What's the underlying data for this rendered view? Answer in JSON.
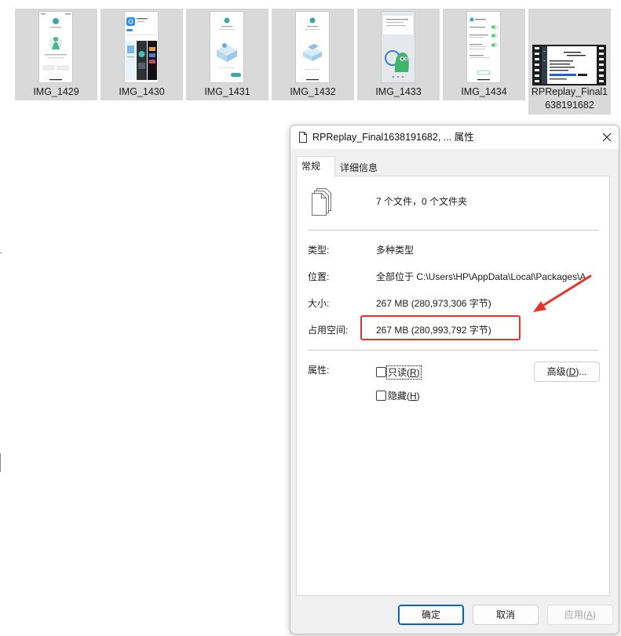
{
  "files": [
    {
      "name": "IMG_1429"
    },
    {
      "name": "IMG_1430"
    },
    {
      "name": "IMG_1431"
    },
    {
      "name": "IMG_1432"
    },
    {
      "name": "IMG_1433"
    },
    {
      "name": "IMG_1434"
    },
    {
      "name": "RPReplay_Final1638191682"
    }
  ],
  "dialog": {
    "title": "RPReplay_Final1638191682, ... 属性",
    "tabs": [
      {
        "label": "常规",
        "active": true
      },
      {
        "label": "详细信息",
        "active": false
      }
    ],
    "summary": "7 个文件，0 个文件夹",
    "rows": [
      {
        "label": "类型:",
        "value": "多种类型"
      },
      {
        "label": "位置:",
        "value": "全部位于 C:\\Users\\HP\\AppData\\Local\\Packages\\A"
      },
      {
        "label": "大小:",
        "value": "267 MB (280,973,306 字节)"
      },
      {
        "label": "占用空间:",
        "value": "267 MB (280,993,792 字节)"
      }
    ],
    "attributes_label": "属性:",
    "readonly": {
      "prefix": "只读(",
      "accel": "R",
      "suffix": ")",
      "checked": false
    },
    "hidden": {
      "prefix": "隐藏(",
      "accel": "H",
      "suffix": ")",
      "checked": false
    },
    "advanced": {
      "prefix": "高级(",
      "accel": "D",
      "suffix": ")..."
    },
    "ok_label": "确定",
    "cancel_label": "取消",
    "apply": {
      "prefix": "应用(",
      "accel": "A",
      "suffix": ")",
      "enabled": false
    }
  },
  "icons": {
    "title": "document-icon",
    "close": "close-icon",
    "summary": "multiple-files-icon"
  },
  "colors": {
    "selection": "#d9d9d9",
    "accent": "#0067c0",
    "annotation": "#e53528"
  }
}
